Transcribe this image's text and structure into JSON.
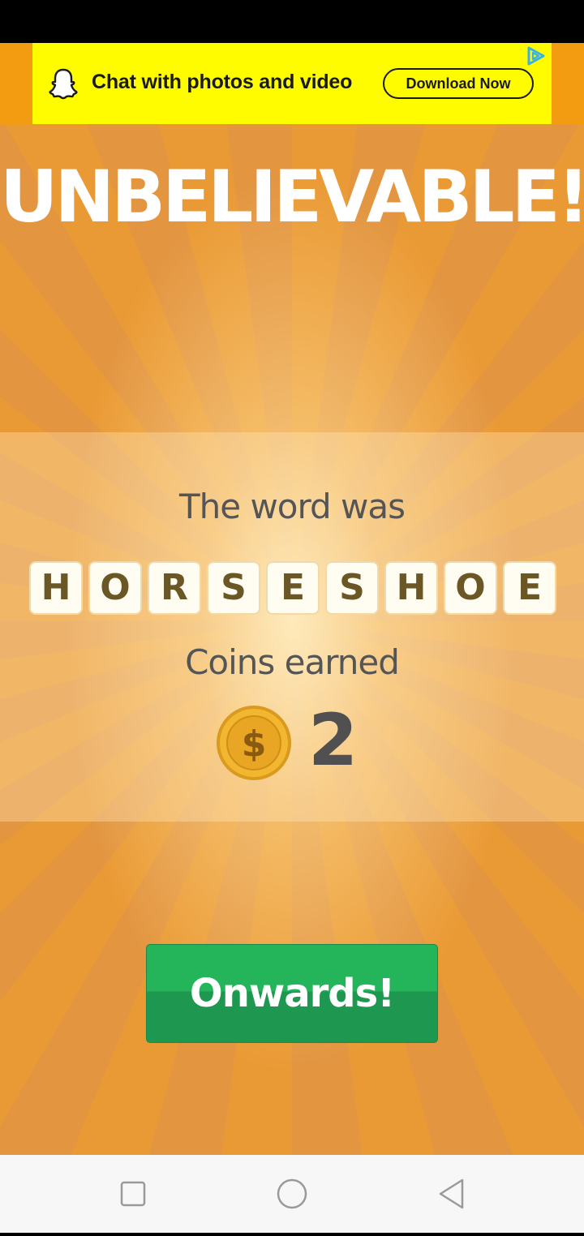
{
  "ad": {
    "text": "Chat with photos and video",
    "button_label": "Download Now",
    "colors": {
      "background": "#fffc00",
      "side": "#f39c12"
    }
  },
  "game": {
    "title": "UNBELIEVABLE!",
    "word_label": "The word was",
    "word_letters": [
      "H",
      "O",
      "R",
      "S",
      "E",
      "S",
      "H",
      "O",
      "E"
    ],
    "coins_label": "Coins earned",
    "coins_value": "2",
    "coin_symbol": "$",
    "onwards_label": "Onwards!",
    "colors": {
      "ray_light": "#ea9a35",
      "ray_dark": "#e39540",
      "button": "#24b55a",
      "tile_text": "#6b5626"
    }
  },
  "nav": {
    "icons": [
      "recent-apps-icon",
      "home-icon",
      "back-icon"
    ]
  }
}
